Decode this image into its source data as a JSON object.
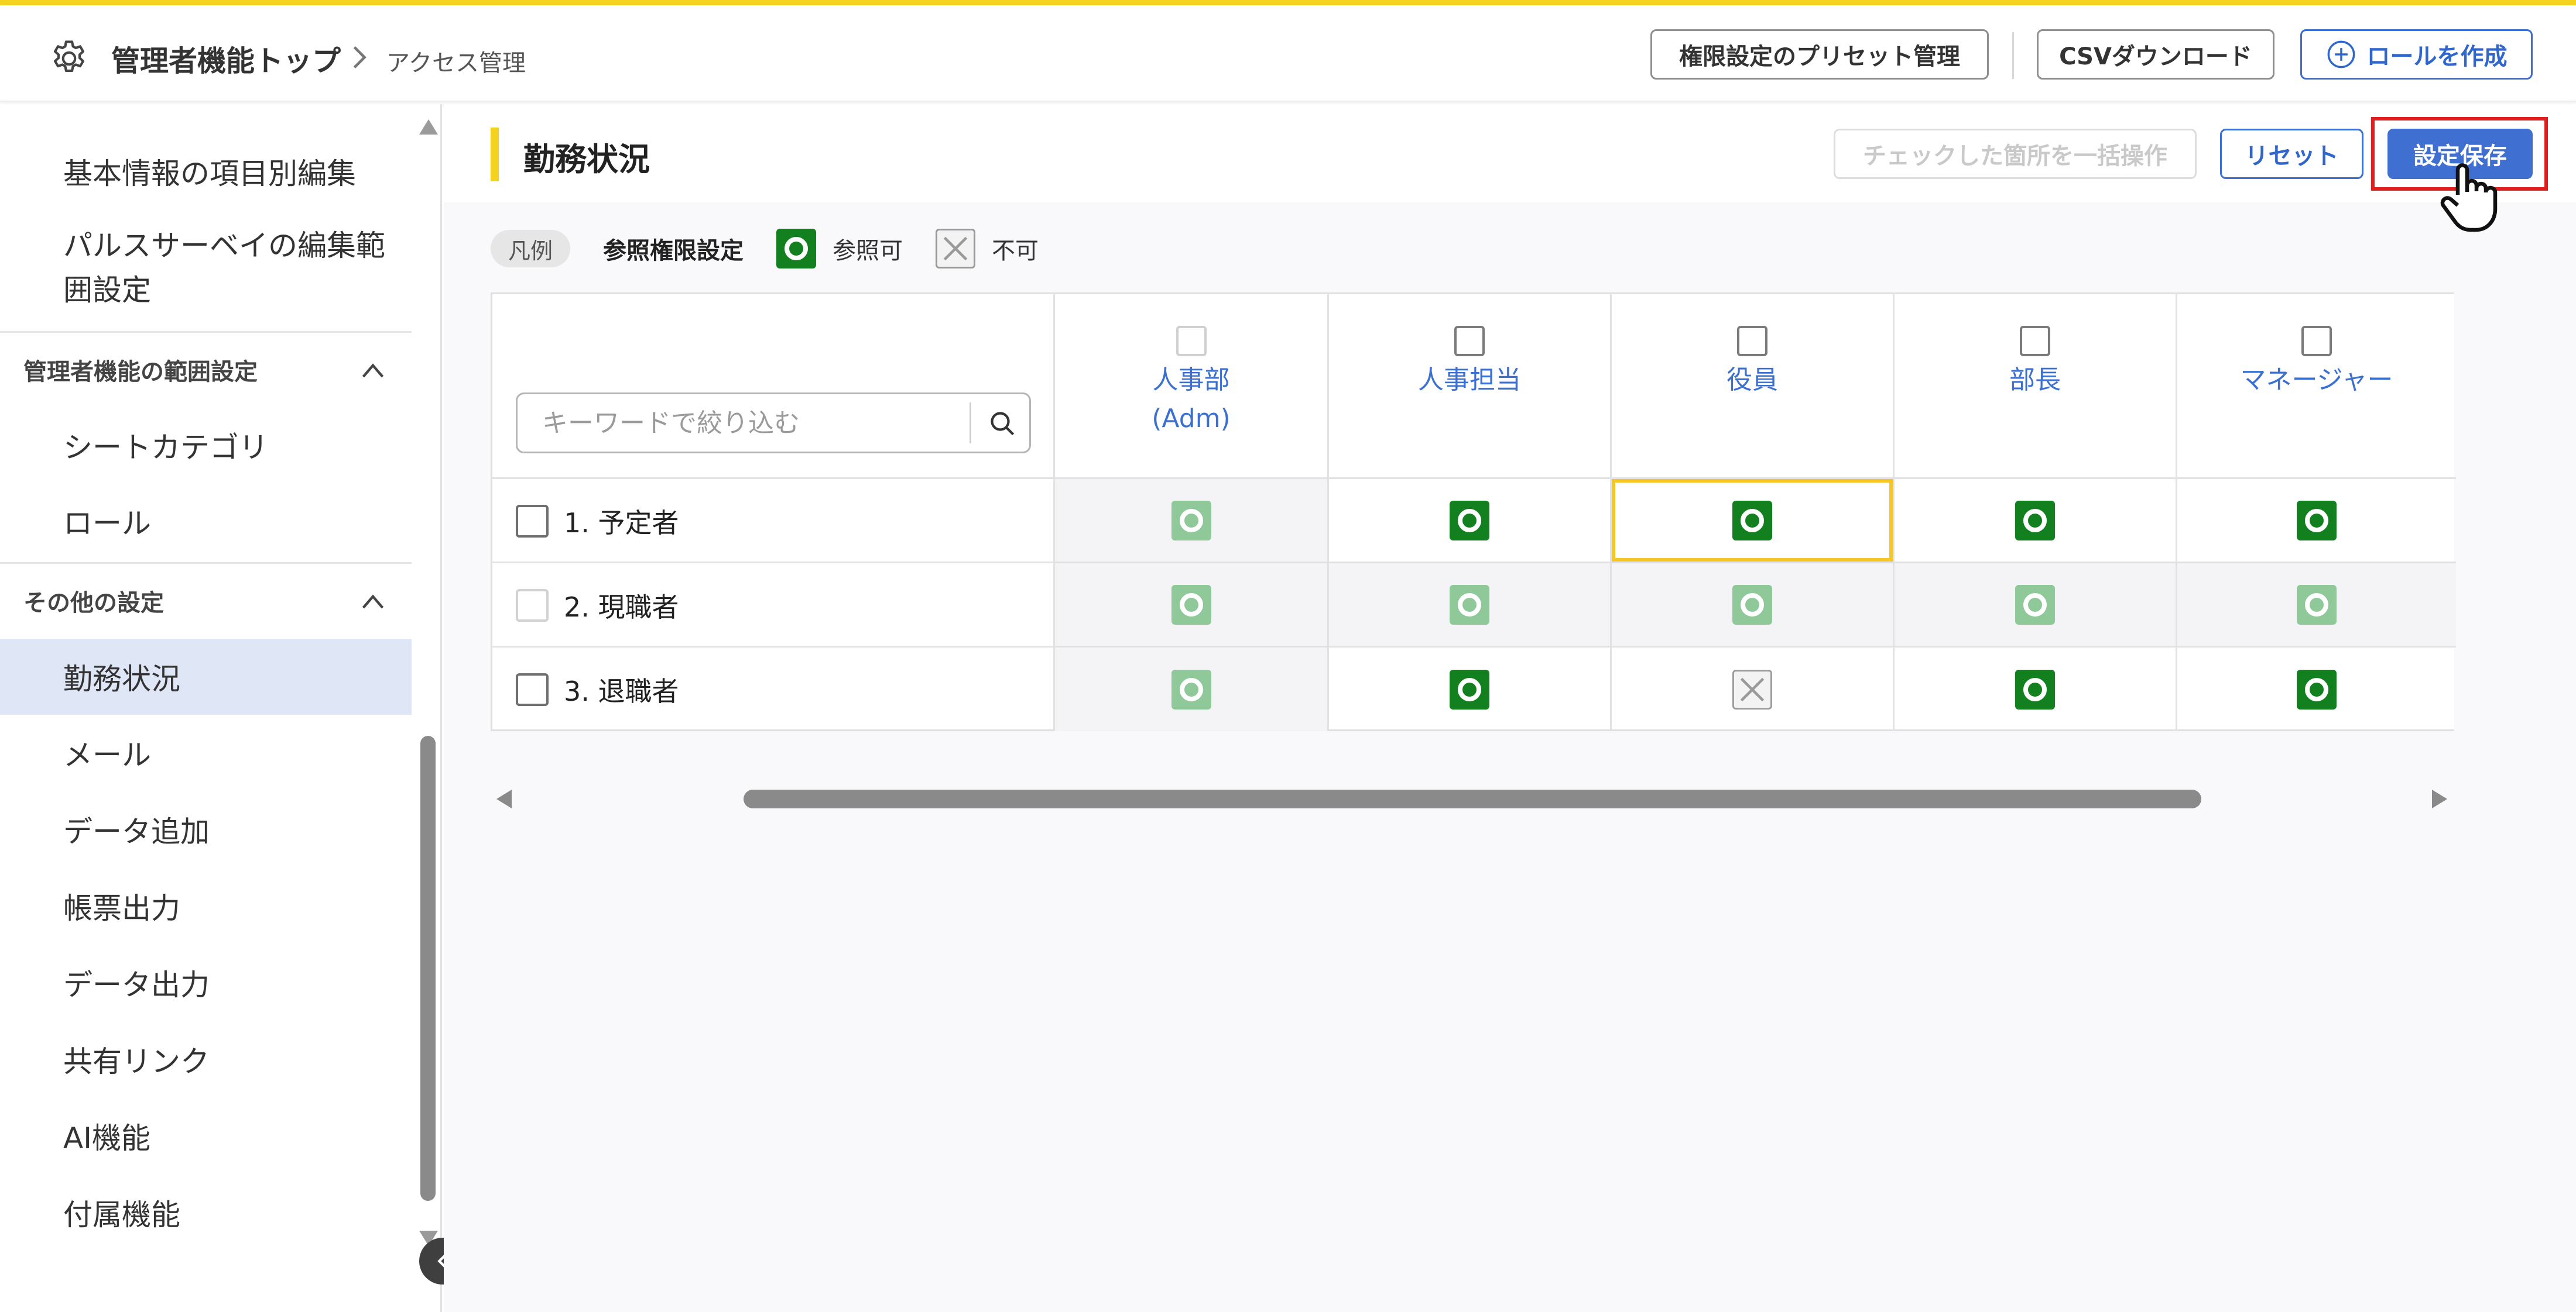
{
  "header": {
    "breadcrumb_main": "管理者機能トップ",
    "breadcrumb_sub": "アクセス管理",
    "preset_button": "権限設定のプリセット管理",
    "csv_button": "CSVダウンロード",
    "create_role_button": "ロールを作成"
  },
  "sidebar": {
    "items_top": [
      "基本情報の項目別編集",
      "パルスサーベイの編集範囲設定"
    ],
    "section_admin_scope": "管理者機能の範囲設定",
    "admin_scope_items": [
      "シートカテゴリ",
      "ロール"
    ],
    "section_other": "その他の設定",
    "other_items": [
      "勤務状況",
      "メール",
      "データ追加",
      "帳票出力",
      "データ出力",
      "共有リンク",
      "AI機能",
      "付属機能"
    ],
    "active_item": "勤務状況"
  },
  "main": {
    "title": "勤務状況",
    "bulk_button": "チェックした箇所を一括操作",
    "reset_button": "リセット",
    "save_button": "設定保存",
    "legend": {
      "tag": "凡例",
      "title": "参照権限設定",
      "ok_label": "参照可",
      "ng_label": "不可"
    },
    "search_placeholder": "キーワードで絞り込む",
    "columns": [
      "人事部\n(Adm)",
      "人事担当",
      "役員",
      "部長",
      "マネージャー"
    ],
    "rows": [
      {
        "label": "1. 予定者",
        "cells": [
          "ok-faint",
          "ok",
          "ok",
          "ok",
          "ok"
        ]
      },
      {
        "label": "2. 現職者",
        "cells": [
          "ok-faint",
          "ok-faint",
          "ok-faint",
          "ok-faint",
          "ok-faint"
        ]
      },
      {
        "label": "3. 退職者",
        "cells": [
          "ok-faint",
          "ok",
          "ng",
          "ok",
          "ok"
        ]
      }
    ]
  },
  "colors": {
    "accent_yellow": "#f5d21e",
    "primary_blue": "#3f6fd1",
    "ok_green": "#13801f",
    "ok_green_faint": "#8fc99a",
    "highlight_red": "#e01e1e"
  }
}
